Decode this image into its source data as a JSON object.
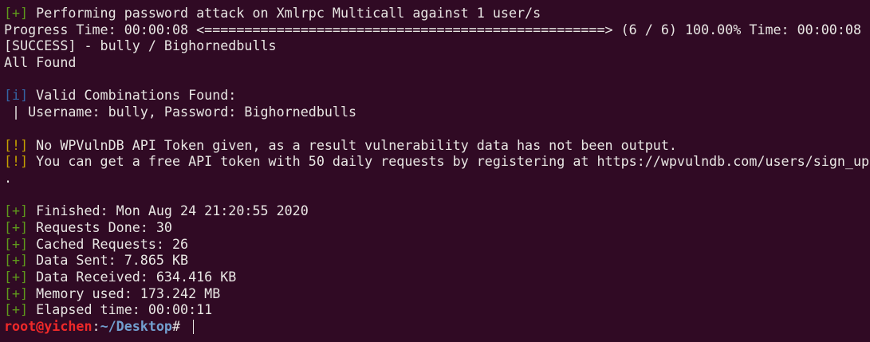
{
  "colors": {
    "background": "#300a24",
    "success": "#5f9a1c",
    "info": "#3465a4",
    "warning": "#c4a000",
    "prompt_user": "#ef2929",
    "prompt_path": "#729fcf"
  },
  "lines": [
    {
      "tag": "[+]",
      "text": " Performing password attack on Xmlrpc Multicall against 1 user/s"
    },
    {
      "text": "Progress Time: 00:00:08 <==================================================> (6 / 6) 100.00% Time: 00:00:08"
    },
    {
      "text": "[SUCCESS] - bully / Bighornedbulls"
    },
    {
      "text": "All Found"
    },
    {
      "text": ""
    },
    {
      "tag": "[i]",
      "text": " Valid Combinations Found:"
    },
    {
      "text": " | Username: bully, Password: Bighornedbulls"
    },
    {
      "text": ""
    },
    {
      "tag": "[!]",
      "text": " No WPVulnDB API Token given, as a result vulnerability data has not been output."
    },
    {
      "tag": "[!]",
      "text": " You can get a free API token with 50 daily requests by registering at https://wpvulndb.com/users/sign_up"
    },
    {
      "text": "."
    },
    {
      "text": ""
    },
    {
      "tag": "[+]",
      "text": " Finished: Mon Aug 24 21:20:55 2020"
    },
    {
      "tag": "[+]",
      "text": " Requests Done: 30"
    },
    {
      "tag": "[+]",
      "text": " Cached Requests: 26"
    },
    {
      "tag": "[+]",
      "text": " Data Sent: 7.865 KB"
    },
    {
      "tag": "[+]",
      "text": " Data Received: 634.416 KB"
    },
    {
      "tag": "[+]",
      "text": " Memory used: 173.242 MB"
    },
    {
      "tag": "[+]",
      "text": " Elapsed time: 00:00:11"
    }
  ],
  "prompt": {
    "user": "root@yichen",
    "sep": ":",
    "path": "~/Desktop",
    "symbol": "# "
  }
}
